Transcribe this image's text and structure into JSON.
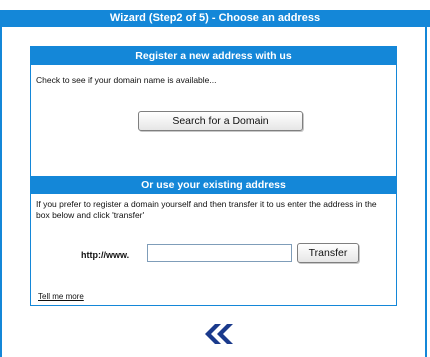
{
  "wizard": {
    "title": "Wizard (Step2 of 5) - Choose an address"
  },
  "register": {
    "heading": "Register a new address with us",
    "description": "Check to see if your domain name is available...",
    "search_button": "Search for a Domain"
  },
  "existing": {
    "heading": "Or use your existing address",
    "description": "If you prefer to register a domain yourself and then transfer it to us enter the address in the box below and click 'transfer'",
    "url_prefix": "http://www.",
    "url_value": "",
    "transfer_button": "Transfer"
  },
  "links": {
    "tell_me_more": "Tell me more"
  },
  "nav": {
    "back_icon": "double-chevron-left-icon"
  },
  "colors": {
    "accent": "#1487d8",
    "back_arrow": "#1a3a8c"
  }
}
